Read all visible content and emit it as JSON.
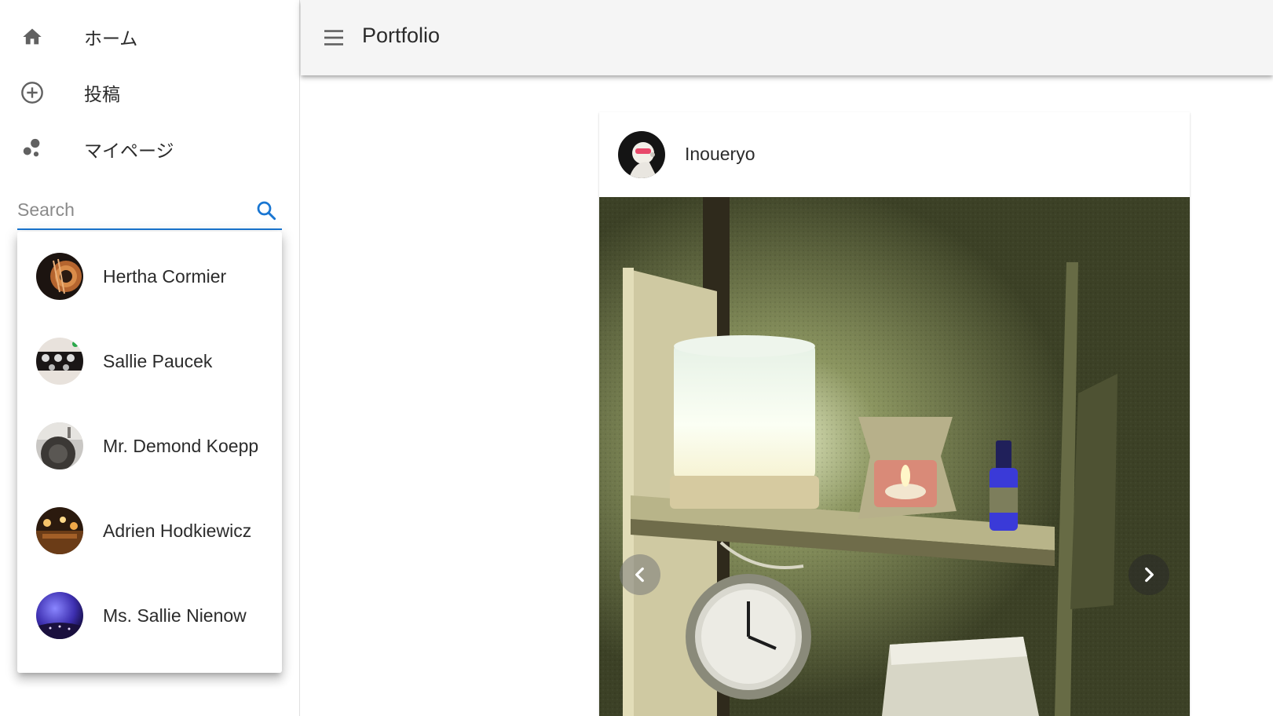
{
  "sidebar": {
    "nav": [
      {
        "label": "ホーム",
        "icon": "home-icon"
      },
      {
        "label": "投稿",
        "icon": "add-circle-icon"
      },
      {
        "label": "マイページ",
        "icon": "bubble-chart-icon"
      }
    ],
    "search": {
      "placeholder": "Search",
      "value": ""
    },
    "results": [
      {
        "name": "Hertha Cormier"
      },
      {
        "name": "Sallie Paucek"
      },
      {
        "name": "Mr. Demond Koepp"
      },
      {
        "name": "Adrien Hodkiewicz"
      },
      {
        "name": "Ms. Sallie Nienow"
      }
    ]
  },
  "topbar": {
    "title": "Portfolio",
    "menu_icon": "menu-icon"
  },
  "post": {
    "username": "Inoueryo",
    "prev_icon": "chevron-left-icon",
    "next_icon": "chevron-right-icon"
  },
  "colors": {
    "accent": "#1976d2",
    "topbar_bg": "#f5f5f5",
    "icon_grey": "#616161"
  }
}
